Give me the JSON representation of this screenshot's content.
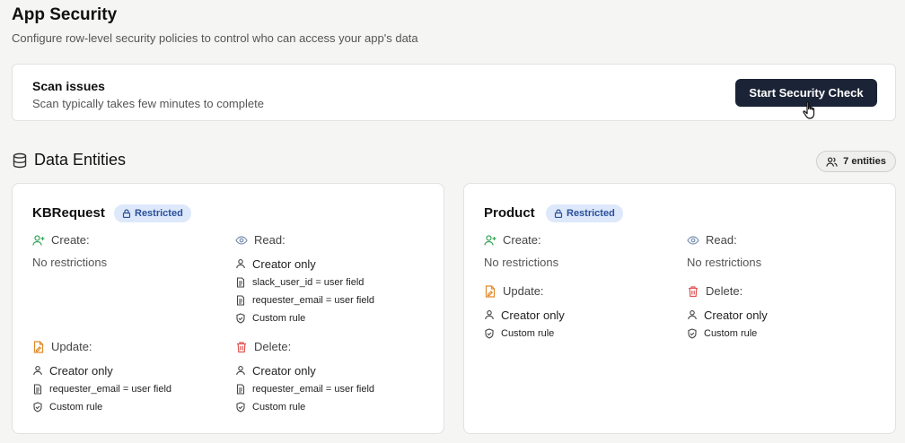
{
  "header": {
    "title": "App Security",
    "subtitle": "Configure row-level security policies to control who can access your app's data"
  },
  "scan": {
    "title": "Scan issues",
    "subtitle": "Scan typically takes few minutes to complete",
    "button_label": "Start Security Check"
  },
  "entities_section": {
    "title": "Data Entities",
    "count_label": "7 entities"
  },
  "entities": [
    {
      "name": "KBRequest",
      "badge": "Restricted",
      "create": {
        "label": "Create:",
        "value": "No restrictions"
      },
      "read": {
        "label": "Read:",
        "rules": [
          "Creator only",
          "slack_user_id = user field",
          "requester_email = user field",
          "Custom rule"
        ]
      },
      "update": {
        "label": "Update:",
        "rules": [
          "Creator only",
          "requester_email = user field",
          "Custom rule"
        ]
      },
      "delete": {
        "label": "Delete:",
        "rules": [
          "Creator only",
          "requester_email = user field",
          "Custom rule"
        ]
      }
    },
    {
      "name": "Product",
      "badge": "Restricted",
      "create": {
        "label": "Create:",
        "value": "No restrictions"
      },
      "read": {
        "label": "Read:",
        "value": "No restrictions"
      },
      "update": {
        "label": "Update:",
        "rules": [
          "Creator only",
          "Custom rule"
        ]
      },
      "delete": {
        "label": "Delete:",
        "rules": [
          "Creator only",
          "Custom rule"
        ]
      }
    }
  ],
  "colors": {
    "button_bg": "#1b2436",
    "badge_bg": "#dde8fb",
    "badge_text": "#2a4f9a",
    "create_icon": "#3aa65a",
    "read_icon": "#7a8fb0",
    "update_icon": "#e08a2a",
    "delete_icon": "#e05555"
  },
  "icons": {
    "section": "database-icon",
    "count": "users-icon",
    "badge": "lock-icon",
    "create": "user-plus-icon",
    "read": "eye-icon",
    "update": "file-edit-icon",
    "delete": "trash-icon",
    "creator": "user-icon",
    "field": "document-icon",
    "custom": "shield-check-icon"
  }
}
